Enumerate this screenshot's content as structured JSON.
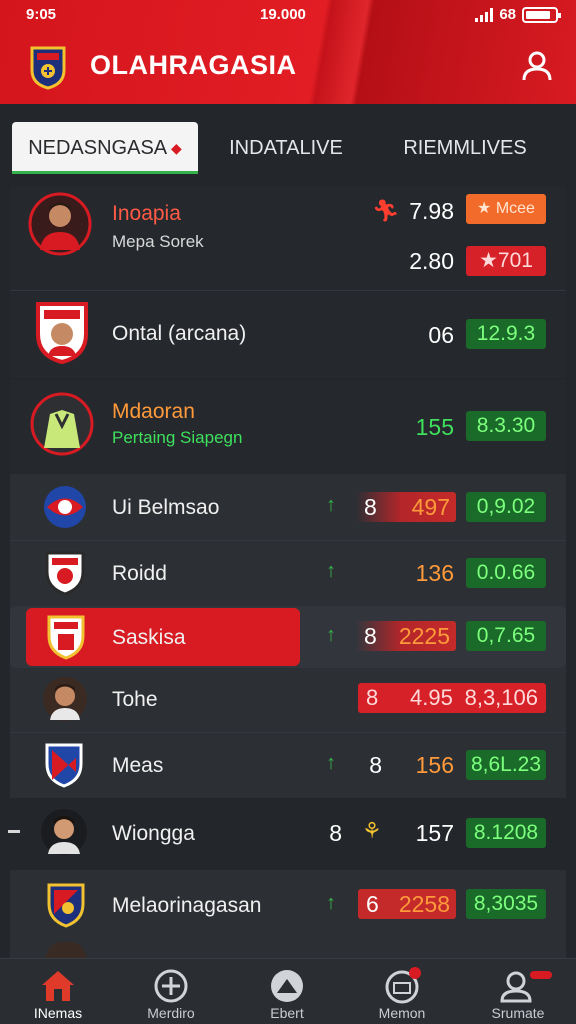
{
  "status_bar": {
    "time": "9:05",
    "center": "19.000",
    "battery_text": "68"
  },
  "header": {
    "title": "OLAHRAGASIA"
  },
  "tabs": [
    {
      "label": "NEDASNGASA",
      "active": true
    },
    {
      "label": "INDATALIVE",
      "active": false
    },
    {
      "label": "RIEMMLIVES",
      "active": false
    }
  ],
  "rows": [
    {
      "name": "Inoapia",
      "sub": "Mepa Sorek",
      "value": "7.98",
      "value2": "2.80",
      "badge": "Mcee",
      "badge2": "701"
    },
    {
      "name": "Ontal (arcana)",
      "value": "06",
      "badge": "12.9.3"
    },
    {
      "name": "Mdaoran",
      "sub": "Pertaing Siapegn",
      "value": "155",
      "badge": "8.3.30"
    },
    {
      "name": "Ui Belmsao",
      "mark": "8",
      "value": "497",
      "badge": "0,9.02"
    },
    {
      "name": "Roidd",
      "value": "136",
      "badge": "0.0.66"
    },
    {
      "name": "Saskisa",
      "mark": "8",
      "value": "2225",
      "badge": "0,7.65"
    },
    {
      "name": "Tohe",
      "mark": "8",
      "value": "4.95",
      "badge": "8,3,106"
    },
    {
      "name": "Meas",
      "mark": "8",
      "value": "156",
      "badge": "8,6L.23"
    },
    {
      "name": "Wiongga",
      "mark": "8",
      "value": "157",
      "badge": "8.1208"
    },
    {
      "name": "Melaorinagasan",
      "mark": "6",
      "value": "2258",
      "badge": "8,3035"
    }
  ],
  "bottom_nav": [
    {
      "label": "INemas",
      "icon": "home-icon"
    },
    {
      "label": "Merdiro",
      "icon": "plus-circle-icon"
    },
    {
      "label": "Ebert",
      "icon": "badge-icon"
    },
    {
      "label": "Memon",
      "icon": "mail-icon"
    },
    {
      "label": "Srumate",
      "icon": "user-icon"
    }
  ],
  "colors": {
    "brand_red": "#d81b22",
    "positive_green": "#35b24a",
    "background": "#23262b"
  }
}
